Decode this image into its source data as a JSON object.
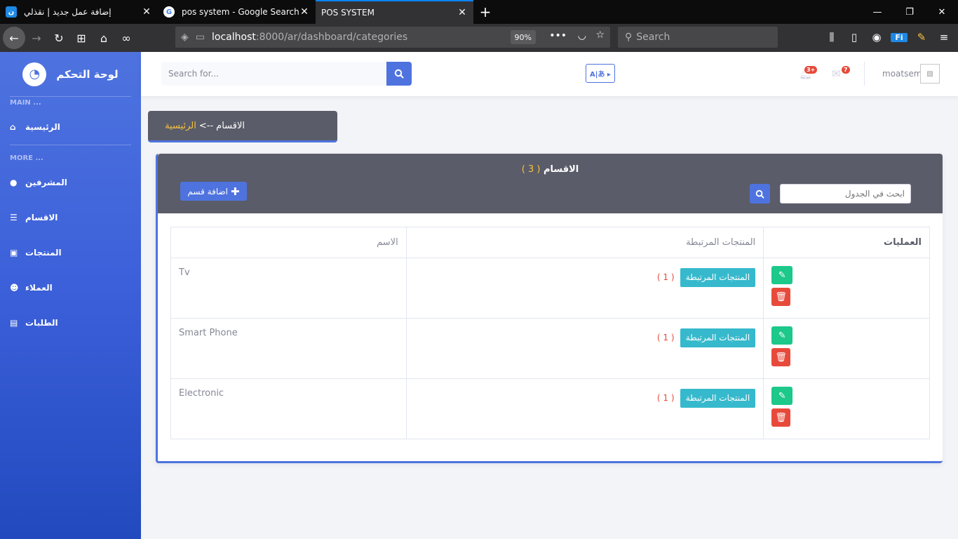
{
  "browser": {
    "tabs": [
      {
        "title": "إضافة عمل جديد | نقذلي",
        "favicon": "ن",
        "active": false
      },
      {
        "title": "pos system - Google Search",
        "favicon": "G",
        "active": false
      },
      {
        "title": "POS SYSTEM",
        "favicon": "",
        "active": true
      }
    ],
    "url_host": "localhost",
    "url_path": ":8000/ar/dashboard/categories",
    "zoom": "90%",
    "search_placeholder": "Search"
  },
  "sidebar": {
    "brand": "لوحة التحكم",
    "heading_main": "MAIN ...",
    "heading_more": "MORE ...",
    "home": "الرئيسية",
    "items": [
      {
        "label": "المشرفين",
        "icon": "user-circle-icon"
      },
      {
        "label": "الاقسام",
        "icon": "list-icon"
      },
      {
        "label": "المنتجات",
        "icon": "boxes-icon"
      },
      {
        "label": "العملاء",
        "icon": "users-icon"
      },
      {
        "label": "الطلبات",
        "icon": "list-alt-icon"
      }
    ]
  },
  "topbar": {
    "search_placeholder": "Search for...",
    "alerts_badge": "3+",
    "messages_badge": "7",
    "username": "moatsem"
  },
  "breadcrumb": {
    "current": "الاقسام",
    "separator": "-->",
    "home": "الرئيسية"
  },
  "card": {
    "title": "الاقسام",
    "count": "( 3 )",
    "add_button": "اضافة قسم",
    "search_placeholder": "ابحث في الجدول"
  },
  "table": {
    "headers": {
      "name": "الاسم",
      "related": "المنتجات المرتبطة",
      "ops": "العمليات"
    },
    "related_button": "المنتجات المرتبطة",
    "rows": [
      {
        "name": "Tv",
        "count": "( 1 )"
      },
      {
        "name": "Smart Phone",
        "count": "( 1 )"
      },
      {
        "name": "Electronic",
        "count": "( 1 )"
      }
    ]
  },
  "colors": {
    "primary": "#4e73df",
    "dark": "#5a5c69",
    "info": "#36b9cc",
    "success": "#1cc88a",
    "danger": "#e74a3b",
    "warning": "#f6c23e"
  }
}
